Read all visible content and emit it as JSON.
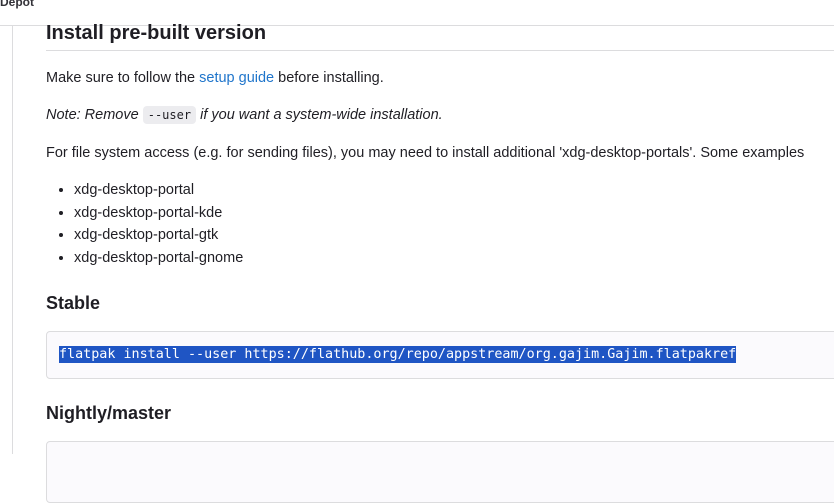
{
  "breadcrumb": "Depot",
  "section_title": "Install pre-built version",
  "intro": {
    "before_link": "Make sure to follow the ",
    "link_text": "setup guide",
    "after_link": " before installing."
  },
  "note": {
    "before": "Note: Remove ",
    "code": "--user",
    "after": " if you want a system-wide installation."
  },
  "file_access_text": "For file system access (e.g. for sending files), you may need to install additional 'xdg-desktop-portals'. Some examples",
  "portals": [
    "xdg-desktop-portal",
    "xdg-desktop-portal-kde",
    "xdg-desktop-portal-gtk",
    "xdg-desktop-portal-gnome"
  ],
  "stable": {
    "heading": "Stable",
    "command": "flatpak install --user https://flathub.org/repo/appstream/org.gajim.Gajim.flatpakref"
  },
  "nightly": {
    "heading": "Nightly/master"
  },
  "colors": {
    "link": "#1f75cb",
    "selection": "#1f55c4",
    "border": "#dcdcde"
  }
}
